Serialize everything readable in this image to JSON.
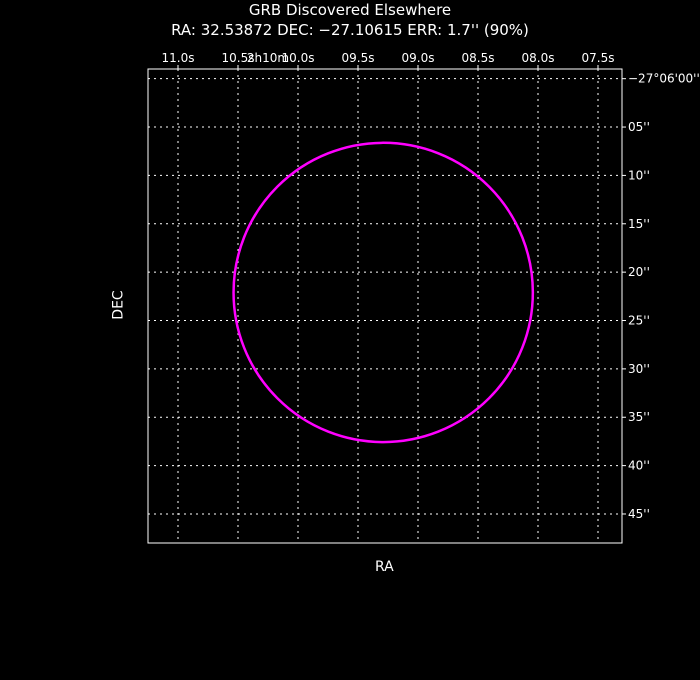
{
  "title": "GRB Discovered Elsewhere",
  "subtitle": "RA: 32.53872   DEC: −27.10615   ERR: 1.7'' (90%)",
  "chart_data": {
    "type": "scatter",
    "title": "GRB Discovered Elsewhere",
    "subtitle": "RA: 32.53872   DEC: −27.10615   ERR: 1.7'' (90%)",
    "xlabel": "RA",
    "ylabel": "DEC",
    "grid": true,
    "x_direction": "decreasing-right",
    "xlim": [
      11.25,
      7.3
    ],
    "ylim": [
      -1,
      48
    ],
    "x_ticks": [
      {
        "value": 11.0,
        "label": "11.0s"
      },
      {
        "value": 10.5,
        "label": "10.5s"
      },
      {
        "value": 10.0,
        "label": "10.0s"
      },
      {
        "value": 9.5,
        "label": "09.5s"
      },
      {
        "value": 9.0,
        "label": "09.0s"
      },
      {
        "value": 8.5,
        "label": "08.5s"
      },
      {
        "value": 8.0,
        "label": "08.0s"
      },
      {
        "value": 7.5,
        "label": "07.5s"
      }
    ],
    "x_major_label": {
      "value": 10.25,
      "label": "2h10m"
    },
    "y_ticks": [
      {
        "value": 0,
        "label": "−27°06'00''"
      },
      {
        "value": 5,
        "label": "05''"
      },
      {
        "value": 10,
        "label": "10''"
      },
      {
        "value": 15,
        "label": "15''"
      },
      {
        "value": 20,
        "label": "20''"
      },
      {
        "value": 25,
        "label": "25''"
      },
      {
        "value": 30,
        "label": "30''"
      },
      {
        "value": 35,
        "label": "35''"
      },
      {
        "value": 40,
        "label": "40''"
      },
      {
        "value": 45,
        "label": "45''"
      }
    ],
    "points": [
      {
        "x": 9.29,
        "y": 22.1,
        "err_arcsec": 1.7,
        "shape": "circle"
      }
    ]
  },
  "colors": {
    "background": "#000000",
    "foreground": "#ffffff",
    "grid": "#ffffff",
    "marker": "#ff00ff"
  }
}
